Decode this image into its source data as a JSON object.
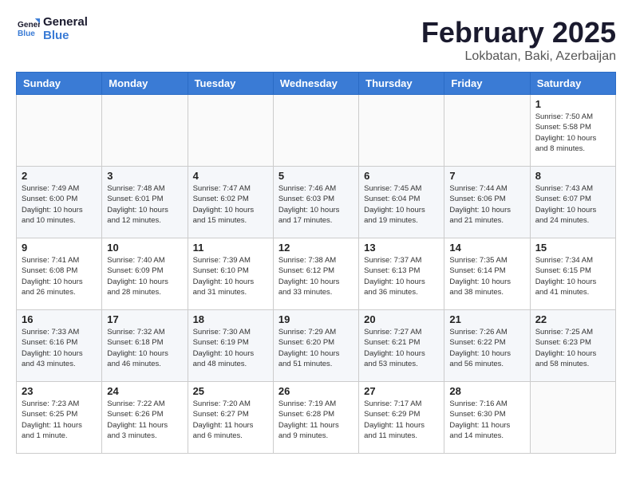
{
  "logo": {
    "line1": "General",
    "line2": "Blue"
  },
  "title": "February 2025",
  "location": "Lokbatan, Baki, Azerbaijan",
  "weekdays": [
    "Sunday",
    "Monday",
    "Tuesday",
    "Wednesday",
    "Thursday",
    "Friday",
    "Saturday"
  ],
  "weeks": [
    [
      {
        "day": "",
        "info": ""
      },
      {
        "day": "",
        "info": ""
      },
      {
        "day": "",
        "info": ""
      },
      {
        "day": "",
        "info": ""
      },
      {
        "day": "",
        "info": ""
      },
      {
        "day": "",
        "info": ""
      },
      {
        "day": "1",
        "info": "Sunrise: 7:50 AM\nSunset: 5:58 PM\nDaylight: 10 hours\nand 8 minutes."
      }
    ],
    [
      {
        "day": "2",
        "info": "Sunrise: 7:49 AM\nSunset: 6:00 PM\nDaylight: 10 hours\nand 10 minutes."
      },
      {
        "day": "3",
        "info": "Sunrise: 7:48 AM\nSunset: 6:01 PM\nDaylight: 10 hours\nand 12 minutes."
      },
      {
        "day": "4",
        "info": "Sunrise: 7:47 AM\nSunset: 6:02 PM\nDaylight: 10 hours\nand 15 minutes."
      },
      {
        "day": "5",
        "info": "Sunrise: 7:46 AM\nSunset: 6:03 PM\nDaylight: 10 hours\nand 17 minutes."
      },
      {
        "day": "6",
        "info": "Sunrise: 7:45 AM\nSunset: 6:04 PM\nDaylight: 10 hours\nand 19 minutes."
      },
      {
        "day": "7",
        "info": "Sunrise: 7:44 AM\nSunset: 6:06 PM\nDaylight: 10 hours\nand 21 minutes."
      },
      {
        "day": "8",
        "info": "Sunrise: 7:43 AM\nSunset: 6:07 PM\nDaylight: 10 hours\nand 24 minutes."
      }
    ],
    [
      {
        "day": "9",
        "info": "Sunrise: 7:41 AM\nSunset: 6:08 PM\nDaylight: 10 hours\nand 26 minutes."
      },
      {
        "day": "10",
        "info": "Sunrise: 7:40 AM\nSunset: 6:09 PM\nDaylight: 10 hours\nand 28 minutes."
      },
      {
        "day": "11",
        "info": "Sunrise: 7:39 AM\nSunset: 6:10 PM\nDaylight: 10 hours\nand 31 minutes."
      },
      {
        "day": "12",
        "info": "Sunrise: 7:38 AM\nSunset: 6:12 PM\nDaylight: 10 hours\nand 33 minutes."
      },
      {
        "day": "13",
        "info": "Sunrise: 7:37 AM\nSunset: 6:13 PM\nDaylight: 10 hours\nand 36 minutes."
      },
      {
        "day": "14",
        "info": "Sunrise: 7:35 AM\nSunset: 6:14 PM\nDaylight: 10 hours\nand 38 minutes."
      },
      {
        "day": "15",
        "info": "Sunrise: 7:34 AM\nSunset: 6:15 PM\nDaylight: 10 hours\nand 41 minutes."
      }
    ],
    [
      {
        "day": "16",
        "info": "Sunrise: 7:33 AM\nSunset: 6:16 PM\nDaylight: 10 hours\nand 43 minutes."
      },
      {
        "day": "17",
        "info": "Sunrise: 7:32 AM\nSunset: 6:18 PM\nDaylight: 10 hours\nand 46 minutes."
      },
      {
        "day": "18",
        "info": "Sunrise: 7:30 AM\nSunset: 6:19 PM\nDaylight: 10 hours\nand 48 minutes."
      },
      {
        "day": "19",
        "info": "Sunrise: 7:29 AM\nSunset: 6:20 PM\nDaylight: 10 hours\nand 51 minutes."
      },
      {
        "day": "20",
        "info": "Sunrise: 7:27 AM\nSunset: 6:21 PM\nDaylight: 10 hours\nand 53 minutes."
      },
      {
        "day": "21",
        "info": "Sunrise: 7:26 AM\nSunset: 6:22 PM\nDaylight: 10 hours\nand 56 minutes."
      },
      {
        "day": "22",
        "info": "Sunrise: 7:25 AM\nSunset: 6:23 PM\nDaylight: 10 hours\nand 58 minutes."
      }
    ],
    [
      {
        "day": "23",
        "info": "Sunrise: 7:23 AM\nSunset: 6:25 PM\nDaylight: 11 hours\nand 1 minute."
      },
      {
        "day": "24",
        "info": "Sunrise: 7:22 AM\nSunset: 6:26 PM\nDaylight: 11 hours\nand 3 minutes."
      },
      {
        "day": "25",
        "info": "Sunrise: 7:20 AM\nSunset: 6:27 PM\nDaylight: 11 hours\nand 6 minutes."
      },
      {
        "day": "26",
        "info": "Sunrise: 7:19 AM\nSunset: 6:28 PM\nDaylight: 11 hours\nand 9 minutes."
      },
      {
        "day": "27",
        "info": "Sunrise: 7:17 AM\nSunset: 6:29 PM\nDaylight: 11 hours\nand 11 minutes."
      },
      {
        "day": "28",
        "info": "Sunrise: 7:16 AM\nSunset: 6:30 PM\nDaylight: 11 hours\nand 14 minutes."
      },
      {
        "day": "",
        "info": ""
      }
    ]
  ]
}
